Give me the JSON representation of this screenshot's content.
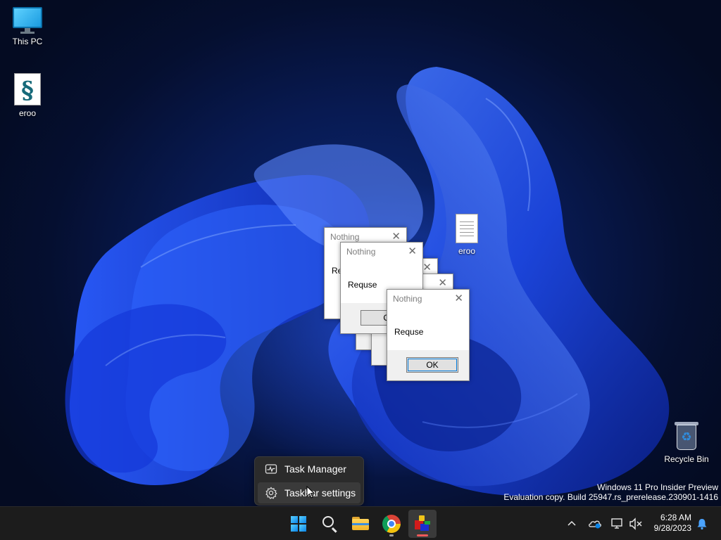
{
  "desktop": {
    "icons": {
      "this_pc": {
        "label": "This PC",
        "icon": "computer-icon"
      },
      "eroo_script": {
        "label": "eroo",
        "icon": "script-file-icon"
      },
      "eroo_text": {
        "label": "eroo",
        "icon": "text-file-icon"
      },
      "recycle_bin": {
        "label": "Recycle Bin",
        "icon": "recycle-bin-icon"
      }
    },
    "watermark": {
      "line1": "Windows 11 Pro Insider Preview",
      "line2": "Evaluation copy. Build 25947.rs_prerelease.230901-1416"
    }
  },
  "dialogs": [
    {
      "title": "Nothing",
      "message": "Re",
      "ok_label": ""
    },
    {
      "title": "Nothing",
      "message": "Requse",
      "ok_label": "O"
    },
    {
      "title": "",
      "message": "",
      "ok_label": ""
    },
    {
      "title": "",
      "message": "",
      "ok_label": ""
    },
    {
      "title": "Nothing",
      "message": "Requse",
      "ok_label": "OK"
    }
  ],
  "context_menu": {
    "items": [
      {
        "label": "Task Manager",
        "icon": "task-manager-icon"
      },
      {
        "label": "Taskbar settings",
        "icon": "gear-icon",
        "hovered": true
      }
    ]
  },
  "taskbar": {
    "apps": [
      {
        "name": "Start",
        "icon": "windows-logo-icon"
      },
      {
        "name": "Search",
        "icon": "search-icon"
      },
      {
        "name": "File Explorer",
        "icon": "folder-icon"
      },
      {
        "name": "Google Chrome",
        "icon": "chrome-icon",
        "running": true
      },
      {
        "name": "eroo",
        "icon": "app-icon",
        "active": true
      }
    ],
    "tray": {
      "icons": [
        "chevron-up-icon",
        "onedrive-icon",
        "network-icon",
        "volume-muted-icon",
        "notification-bell-icon"
      ]
    },
    "clock": {
      "time": "6:28 AM",
      "date": "9/28/2023"
    }
  },
  "colors": {
    "accent": "#0a84e8",
    "taskbar_bg": "#1c1c1c",
    "active_indicator": "#f25a5a"
  }
}
